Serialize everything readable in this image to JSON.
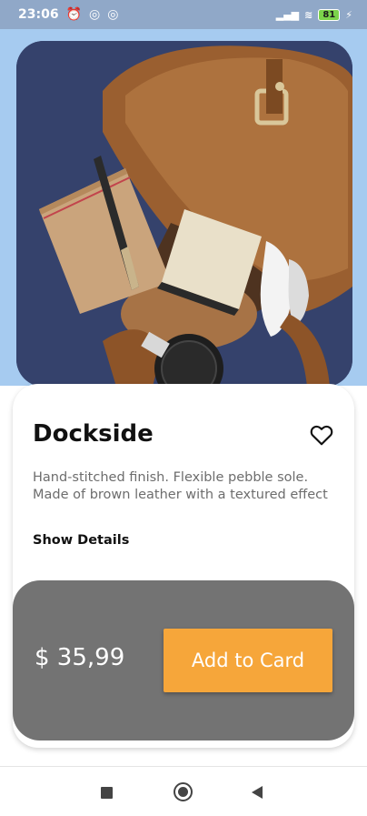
{
  "status_bar": {
    "time": "23:06",
    "battery": "81",
    "icons": [
      "alarm-icon",
      "sync-icon",
      "sync-icon",
      "signal-icon",
      "wifi-icon",
      "battery-icon",
      "charging-icon"
    ]
  },
  "product": {
    "image_subject": "brown leather bag with notebook, pen, wallet and sunglasses",
    "title": "Dockside",
    "description": "Hand-stitched finish. Flexible pebble sole. Made of brown leather with a textured effect",
    "show_details": "Show Details",
    "favorite_icon": "heart-outline-icon"
  },
  "purchase": {
    "price": "$ 35,99",
    "button_label": "Add to Card"
  },
  "colors": {
    "hero_background": "#a6cbf0",
    "price_panel": "#737373",
    "accent_button": "#f6a63a",
    "text_dark": "#111111",
    "text_muted": "#6d6d6d"
  },
  "nav_bar": {
    "items": [
      "recent-apps-icon",
      "home-icon",
      "back-icon"
    ]
  }
}
